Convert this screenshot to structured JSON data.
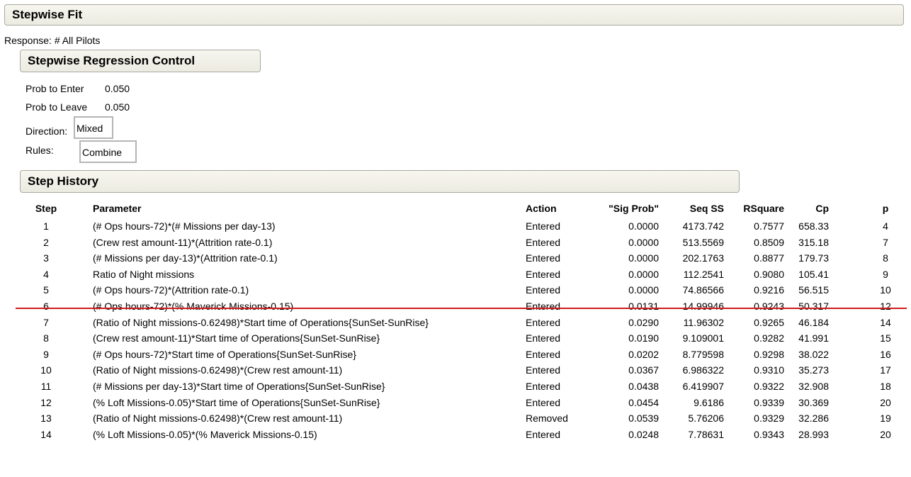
{
  "header": {
    "title": "Stepwise Fit"
  },
  "response": "Response: # All Pilots",
  "control": {
    "title": "Stepwise Regression Control",
    "prob_enter_label": "Prob to Enter",
    "prob_enter_value": "0.050",
    "prob_leave_label": "Prob to Leave",
    "prob_leave_value": "0.050",
    "direction_label": "Direction:",
    "direction_value": "Mixed",
    "rules_label": "Rules:",
    "rules_value": "Combine"
  },
  "history": {
    "title": "Step History",
    "columns": {
      "step": "Step",
      "parameter": "Parameter",
      "action": "Action",
      "sig_prob": "\"Sig Prob\"",
      "seq_ss": "Seq SS",
      "rsquare": "RSquare",
      "cp": "Cp",
      "p": "p"
    },
    "rows": [
      {
        "step": "1",
        "parameter": "(# Ops hours-72)*(# Missions per day-13)",
        "action": "Entered",
        "sig_prob": "0.0000",
        "seq_ss": "4173.742",
        "rsquare": "0.7577",
        "cp": "658.33",
        "p": "4"
      },
      {
        "step": "2",
        "parameter": "(Crew rest amount-11)*(Attrition rate-0.1)",
        "action": "Entered",
        "sig_prob": "0.0000",
        "seq_ss": "513.5569",
        "rsquare": "0.8509",
        "cp": "315.18",
        "p": "7"
      },
      {
        "step": "3",
        "parameter": "(# Missions per day-13)*(Attrition rate-0.1)",
        "action": "Entered",
        "sig_prob": "0.0000",
        "seq_ss": "202.1763",
        "rsquare": "0.8877",
        "cp": "179.73",
        "p": "8"
      },
      {
        "step": "4",
        "parameter": "Ratio of Night missions",
        "action": "Entered",
        "sig_prob": "0.0000",
        "seq_ss": "112.2541",
        "rsquare": "0.9080",
        "cp": "105.41",
        "p": "9"
      },
      {
        "step": "5",
        "parameter": "(# Ops hours-72)*(Attrition rate-0.1)",
        "action": "Entered",
        "sig_prob": "0.0000",
        "seq_ss": "74.86566",
        "rsquare": "0.9216",
        "cp": "56.515",
        "p": "10"
      },
      {
        "step": "6",
        "parameter": "(# Ops hours-72)*(% Maverick Missions-0.15)",
        "action": "Entered",
        "sig_prob": "0.0131",
        "seq_ss": "14.99946",
        "rsquare": "0.9243",
        "cp": "50.317",
        "p": "12"
      },
      {
        "step": "7",
        "parameter": "(Ratio of Night missions-0.62498)*Start time of Operations{SunSet-SunRise}",
        "action": "Entered",
        "sig_prob": "0.0290",
        "seq_ss": "11.96302",
        "rsquare": "0.9265",
        "cp": "46.184",
        "p": "14"
      },
      {
        "step": "8",
        "parameter": "(Crew rest amount-11)*Start time of Operations{SunSet-SunRise}",
        "action": "Entered",
        "sig_prob": "0.0190",
        "seq_ss": "9.109001",
        "rsquare": "0.9282",
        "cp": "41.991",
        "p": "15"
      },
      {
        "step": "9",
        "parameter": "(# Ops hours-72)*Start time of Operations{SunSet-SunRise}",
        "action": "Entered",
        "sig_prob": "0.0202",
        "seq_ss": "8.779598",
        "rsquare": "0.9298",
        "cp": "38.022",
        "p": "16"
      },
      {
        "step": "10",
        "parameter": "(Ratio of Night missions-0.62498)*(Crew rest amount-11)",
        "action": "Entered",
        "sig_prob": "0.0367",
        "seq_ss": "6.986322",
        "rsquare": "0.9310",
        "cp": "35.273",
        "p": "17"
      },
      {
        "step": "11",
        "parameter": "(# Missions per day-13)*Start time of Operations{SunSet-SunRise}",
        "action": "Entered",
        "sig_prob": "0.0438",
        "seq_ss": "6.419907",
        "rsquare": "0.9322",
        "cp": "32.908",
        "p": "18"
      },
      {
        "step": "12",
        "parameter": "(% Loft Missions-0.05)*Start time of Operations{SunSet-SunRise}",
        "action": "Entered",
        "sig_prob": "0.0454",
        "seq_ss": "9.6186",
        "rsquare": "0.9339",
        "cp": "30.369",
        "p": "20"
      },
      {
        "step": "13",
        "parameter": "(Ratio of Night missions-0.62498)*(Crew rest amount-11)",
        "action": "Removed",
        "sig_prob": "0.0539",
        "seq_ss": "5.76206",
        "rsquare": "0.9329",
        "cp": "32.286",
        "p": "19"
      },
      {
        "step": "14",
        "parameter": "(% Loft Missions-0.05)*(% Maverick Missions-0.15)",
        "action": "Entered",
        "sig_prob": "0.0248",
        "seq_ss": "7.78631",
        "rsquare": "0.9343",
        "cp": "28.993",
        "p": "20"
      }
    ]
  },
  "colors": {
    "divider_line": "#d11a1a",
    "header_bg": "#ecebe1"
  }
}
